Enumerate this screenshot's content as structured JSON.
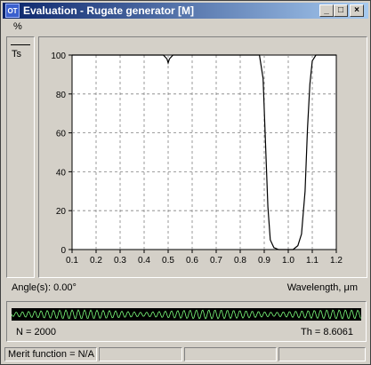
{
  "window": {
    "title": "Evaluation - Rugate generator [M]",
    "icon_text": "OT",
    "minimize_glyph": "_",
    "maximize_glyph": "□",
    "close_glyph": "×"
  },
  "menu": {
    "items": [
      "%"
    ]
  },
  "legend": {
    "label": "Ts"
  },
  "chart_data": {
    "type": "line",
    "series": [
      {
        "name": "Ts",
        "x": [
          0.1,
          0.48,
          0.495,
          0.5,
          0.505,
          0.52,
          0.88,
          0.895,
          0.905,
          0.915,
          0.925,
          0.94,
          0.96,
          0.98,
          1.0,
          1.02,
          1.04,
          1.055,
          1.07,
          1.08,
          1.09,
          1.1,
          1.115,
          1.2
        ],
        "y": [
          100,
          100,
          98,
          96,
          98,
          100,
          100,
          88,
          55,
          22,
          5,
          1,
          0,
          0,
          0,
          0,
          2,
          8,
          30,
          62,
          85,
          97,
          100,
          100
        ]
      }
    ],
    "xlim": [
      0.1,
      1.2
    ],
    "ylim": [
      0,
      100
    ],
    "xticks": [
      "0.1",
      "0.2",
      "0.3",
      "0.4",
      "0.5",
      "0.6",
      "0.7",
      "0.8",
      "0.9",
      "1.0",
      "1.1",
      "1.2"
    ],
    "yticks": [
      "0",
      "20",
      "40",
      "60",
      "80",
      "100"
    ],
    "grid": true,
    "xlabel": "Wavelength, μm",
    "ylabel": "%"
  },
  "angle": {
    "text": "Angle(s): 0.00°"
  },
  "profile": {
    "n_text": "N = 2000",
    "th_text": "Th = 8.6061"
  },
  "status": {
    "merit": "Merit function = N/A"
  },
  "colors": {
    "title_start": "#0a246a",
    "title_end": "#a6caf0",
    "strip": "#000000",
    "profile_line": "#7cfc7c",
    "face": "#d4d0c8"
  }
}
